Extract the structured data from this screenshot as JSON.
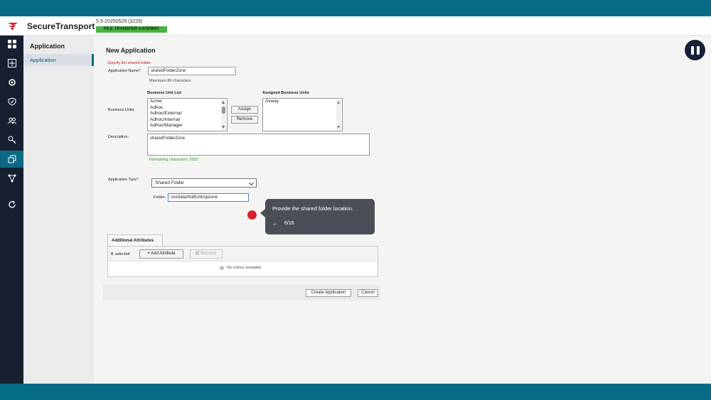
{
  "header": {
    "brand": "SecureTransport",
    "version": "5.5-20250529 (3229)",
    "badge": "FILE TRANSFER GATEWAY"
  },
  "subnav": {
    "title": "Application",
    "items": [
      {
        "label": "Application"
      }
    ]
  },
  "form": {
    "page_title": "New Application",
    "hint": "Specify the shared folder.",
    "app_name_label": "Application Name*:",
    "app_name_value": "sharedFolderZone",
    "app_name_note": "Maximum 80 characters",
    "business_units_label": "Business Units:",
    "bu_list_header": "Business Unit List",
    "bu_list": [
      "Acme",
      "Adhoc",
      "Adhoc/External",
      "Adhoc/Internal",
      "Adhoc/Manager"
    ],
    "assigned_header": "Assigned Business Units",
    "assigned_list": [
      "Axway"
    ],
    "assign_btn": "Assign",
    "remove_btn": "Remove",
    "description_label": "Description:",
    "description_value": "sharedFolderZone",
    "remaining_note": "Remaining characters: 2032",
    "app_type_label": "Application Type*:",
    "app_type_value": "Shared Folder",
    "folder_label": "Folder:",
    "folder_value": "/usrdata/NoBU/dropzone"
  },
  "tooltip": {
    "text": "Provide the shared folder location.",
    "back": "←",
    "step": "6/16"
  },
  "attributes": {
    "tab_label": "Additional Attributes",
    "selected_count": "0",
    "selected_label": "selected",
    "add_btn": "Add Attribute",
    "add_icon": "+",
    "remove_btn": "Remove",
    "empty_text": "No entries available"
  },
  "footer": {
    "create_btn": "Create Application",
    "cancel_btn": "Cancel"
  },
  "colors": {
    "frame": "#066b85",
    "nav_bg": "#16202e",
    "nav_active": "#0b6985",
    "badge": "#48b241",
    "hotspot": "#d7202a",
    "tooltip": "#4a4f57"
  }
}
